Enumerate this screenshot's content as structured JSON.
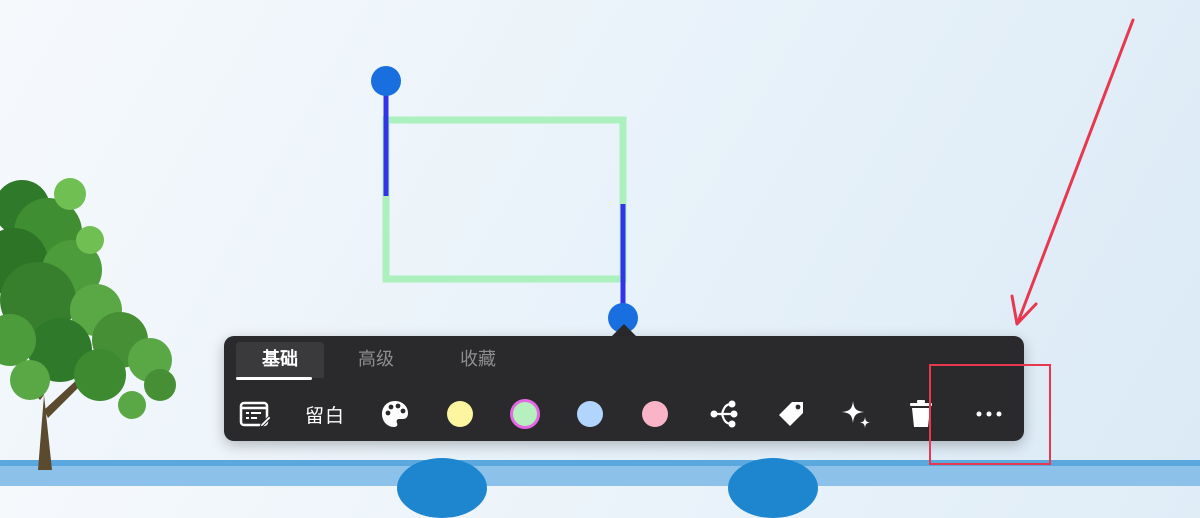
{
  "tabs": [
    {
      "label": "基础",
      "active": true
    },
    {
      "label": "高级",
      "active": false
    },
    {
      "label": "收藏",
      "active": false
    }
  ],
  "tools": {
    "whitespace_label": "留白"
  },
  "colors": {
    "swatch_yellow": "#fdf5a0",
    "swatch_green": "#b5f0be",
    "swatch_green_selected_ring": "#e268e4",
    "swatch_blue": "#b2d5fd",
    "swatch_pink": "#f9b4c8",
    "shape_border": "#abf0bd",
    "connector_line": "#3333e8",
    "handle": "#1a6fe0",
    "annotation": "#e8384f",
    "toolbar_bg": "#2a2a2c"
  },
  "icons": [
    "text-edit-icon",
    "palette-icon",
    "branch-icon",
    "tag-icon",
    "sparkle-icon",
    "trash-icon",
    "more-icon"
  ]
}
